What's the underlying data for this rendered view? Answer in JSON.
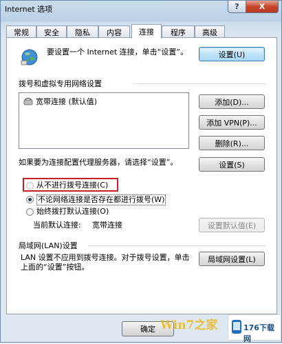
{
  "window": {
    "title": "Internet 选项",
    "help_label": "?",
    "close_label": "X"
  },
  "tabs": [
    {
      "label": "常规"
    },
    {
      "label": "安全"
    },
    {
      "label": "隐私"
    },
    {
      "label": "内容"
    },
    {
      "label": "连接",
      "active": true
    },
    {
      "label": "程序"
    },
    {
      "label": "高级"
    }
  ],
  "setup": {
    "text": "要设置一个 Internet 连接，单击“设置”。",
    "button": "设置(U)"
  },
  "dialup": {
    "group_label": "拨号和虚拟专用网络设置",
    "connections": [
      "宽带连接 (默认值)"
    ],
    "add_button": "添加(D)...",
    "add_vpn_button": "添加 VPN(P)...",
    "delete_button": "删除(R)...",
    "proxy_text": "如果要为连接配置代理服务器，请选择“设置”。",
    "settings_button": "设置(S)",
    "options": [
      {
        "label": "从不进行拨号连接(C)",
        "selected": false,
        "highlighted": true
      },
      {
        "label": "不论网络连接是否存在都进行拨号(W)",
        "selected": true
      },
      {
        "label": "始终拨打默认连接(O)",
        "selected": false
      }
    ],
    "current_default_label": "当前默认连接:",
    "current_default_value": "宽带连接",
    "set_default_button": "设置默认值(E)"
  },
  "lan": {
    "group_label": "局域网(LAN)设置",
    "text": "LAN 设置不应用到拨号连接。对于拨号设置，单击上面的“设置”按钮。",
    "button": "局域网设置(L)"
  },
  "footer": {
    "ok_button": "确定"
  },
  "watermark": {
    "text": "Win7之家",
    "logo_text": "176下载网"
  },
  "colors": {
    "highlight_box": "#c81e25",
    "close_button": "#c7462d"
  }
}
